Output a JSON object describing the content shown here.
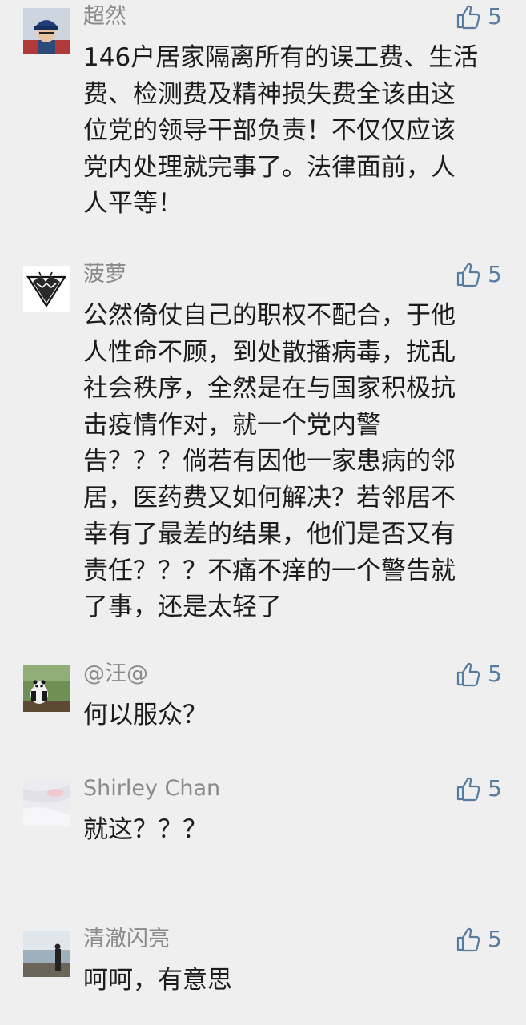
{
  "comments": [
    {
      "author": "超然",
      "likes": "5",
      "avatar_icon": "person-with-cap-avatar",
      "lines": [
        "146户居家隔离所有的误工费、生活",
        "费、检测费及精神损失费全该由这",
        "位党的领导干部负责！不仅仅应该",
        "党内处理就完事了。法律面前，人",
        "人平等！"
      ]
    },
    {
      "author": "菠萝",
      "likes": "5",
      "avatar_icon": "mountain-triangle-avatar",
      "lines": [
        "公然倚仗自己的职权不配合，于他",
        "人性命不顾，到处散播病毒，扰乱",
        "社会秩序，全然是在与国家积极抗",
        "击疫情作对，就一个党内警",
        "告？？？倘若有因他一家患病的邻",
        "居，医药费又如何解决？若邻居不",
        "幸有了最差的结果，他们是否又有",
        "责任？？？不痛不痒的一个警告就",
        "了事，还是太轻了"
      ]
    },
    {
      "author": "@汪@",
      "likes": "5",
      "avatar_icon": "panda-avatar",
      "lines": [
        "何以服众？"
      ]
    },
    {
      "author": "Shirley Chan",
      "likes": "5",
      "avatar_icon": "pale-fabric-avatar",
      "lines": [
        "就这？？？"
      ]
    },
    {
      "author": "清澈闪亮",
      "likes": "5",
      "avatar_icon": "person-by-water-avatar",
      "lines": [
        "呵呵，有意思"
      ]
    }
  ],
  "colors": {
    "background": "#efefef",
    "author": "#8a8a8a",
    "body_text": "#1c1c1c",
    "like_accent": "#587ba0"
  }
}
